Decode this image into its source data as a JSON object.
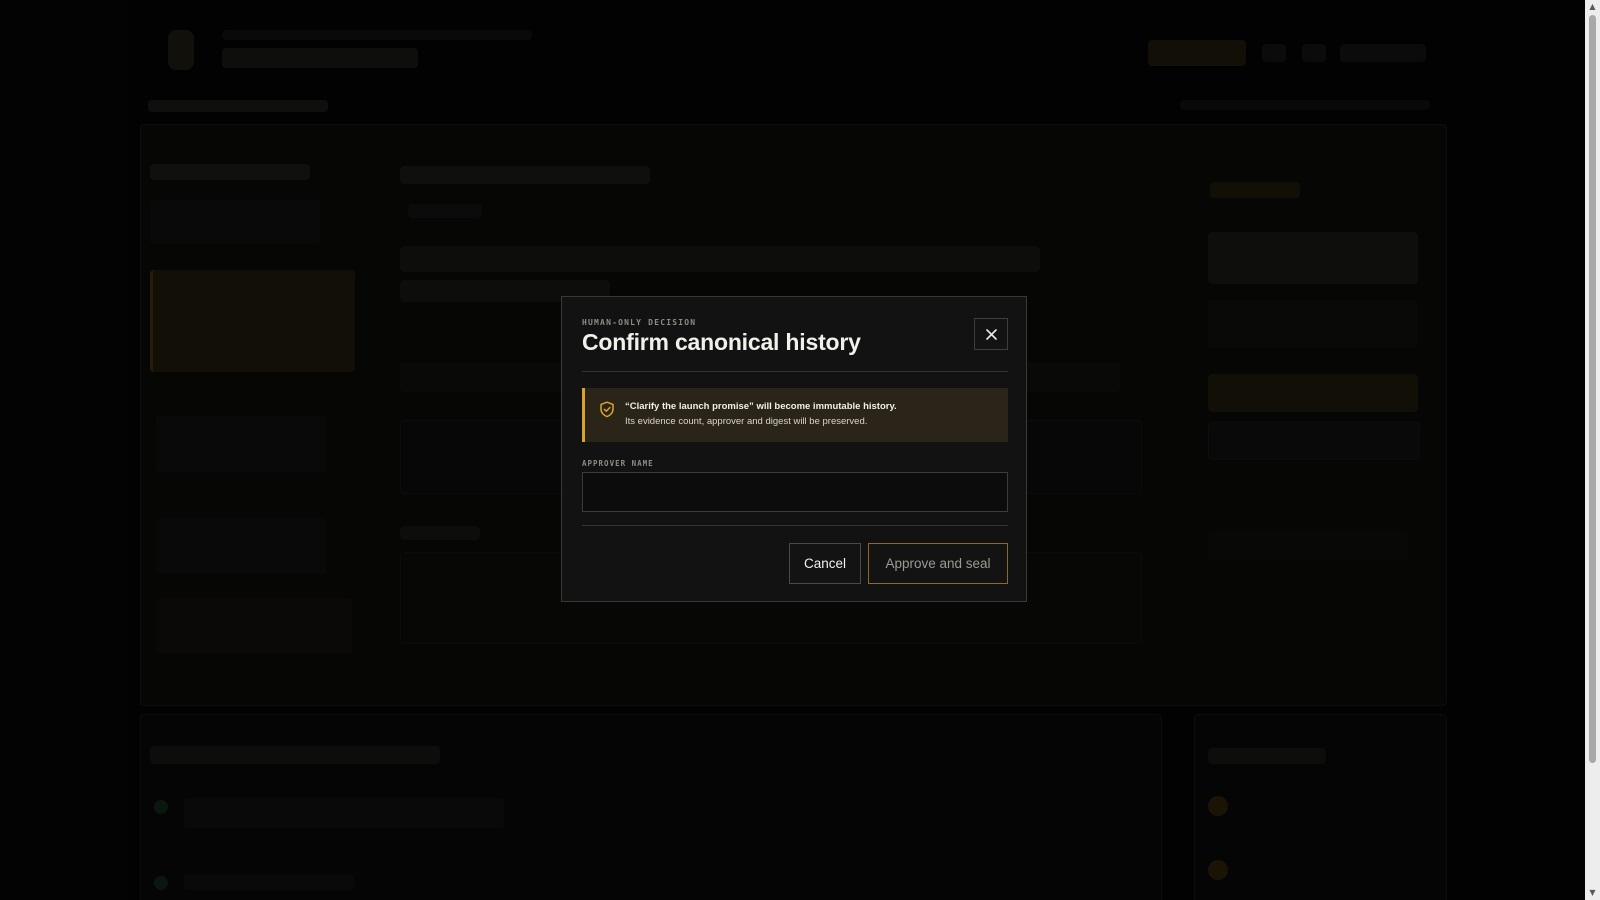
{
  "modal": {
    "eyebrow": "HUMAN-ONLY DECISION",
    "title": "Confirm canonical history",
    "close_icon": "close-icon",
    "warning": {
      "icon": "shield-check-icon",
      "line1": "“Clarify the launch promise” will become immutable history.",
      "line2": "Its evidence count, approver and digest will be preserved."
    },
    "approver_field": {
      "label": "APPROVER NAME",
      "value": "",
      "placeholder": ""
    },
    "buttons": {
      "cancel": "Cancel",
      "approve": "Approve and seal"
    }
  },
  "colors": {
    "accent": "#d9a32f",
    "warning_bg": "#2a2518",
    "modal_bg": "#111211",
    "overlay": "#040404"
  }
}
